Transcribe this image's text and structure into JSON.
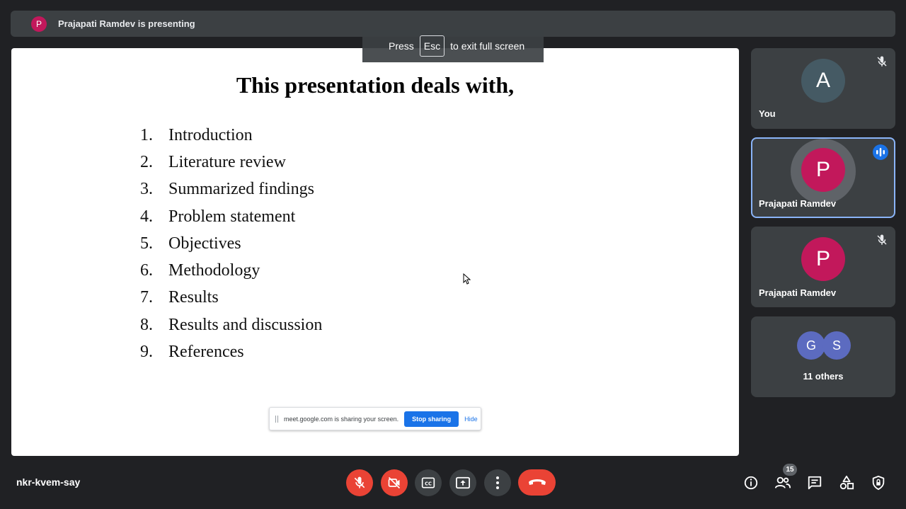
{
  "topbar": {
    "avatar_letter": "P",
    "presenting_text": "Prajapati Ramdev is presenting"
  },
  "fullscreen_banner": {
    "press": "Press",
    "key": "Esc",
    "rest": "to exit full screen"
  },
  "slide": {
    "title": "This presentation deals with,",
    "items": [
      {
        "num": "1.",
        "text": "Introduction"
      },
      {
        "num": "2.",
        "text": "Literature review"
      },
      {
        "num": "3.",
        "text": "Summarized findings"
      },
      {
        "num": "4.",
        "text": "Problem statement"
      },
      {
        "num": "5.",
        "text": "Objectives"
      },
      {
        "num": "6.",
        "text": "Methodology"
      },
      {
        "num": "7.",
        "text": "Results"
      },
      {
        "num": "8.",
        "text": "Results and discussion"
      },
      {
        "num": "9.",
        "text": "References"
      }
    ]
  },
  "share_bar": {
    "message": "meet.google.com is sharing your screen.",
    "stop_label": "Stop sharing",
    "hide_label": "Hide"
  },
  "participants": [
    {
      "letter": "A",
      "name": "You",
      "avatar_color": "#455a64",
      "muted": true
    },
    {
      "letter": "P",
      "name": "Prajapati Ramdev",
      "avatar_color": "#c2185b",
      "speaking": true
    },
    {
      "letter": "P",
      "name": "Prajapati Ramdev",
      "avatar_color": "#c2185b",
      "muted": true
    }
  ],
  "others": {
    "letters": [
      "G",
      "S"
    ],
    "colors": [
      "#5c6bc0",
      "#5c6bc0"
    ],
    "label": "11 others"
  },
  "meeting_code": "nkr-kvem-say",
  "people_count": "15",
  "colors": {
    "background": "#202124",
    "tile": "#3c4043",
    "danger": "#ea4335",
    "accent": "#1a73e8"
  },
  "icons": [
    "mic-off-icon",
    "camera-off-icon",
    "captions-icon",
    "present-icon",
    "more-options-icon",
    "end-call-icon",
    "info-icon",
    "people-icon",
    "chat-icon",
    "activities-icon",
    "host-controls-icon"
  ]
}
